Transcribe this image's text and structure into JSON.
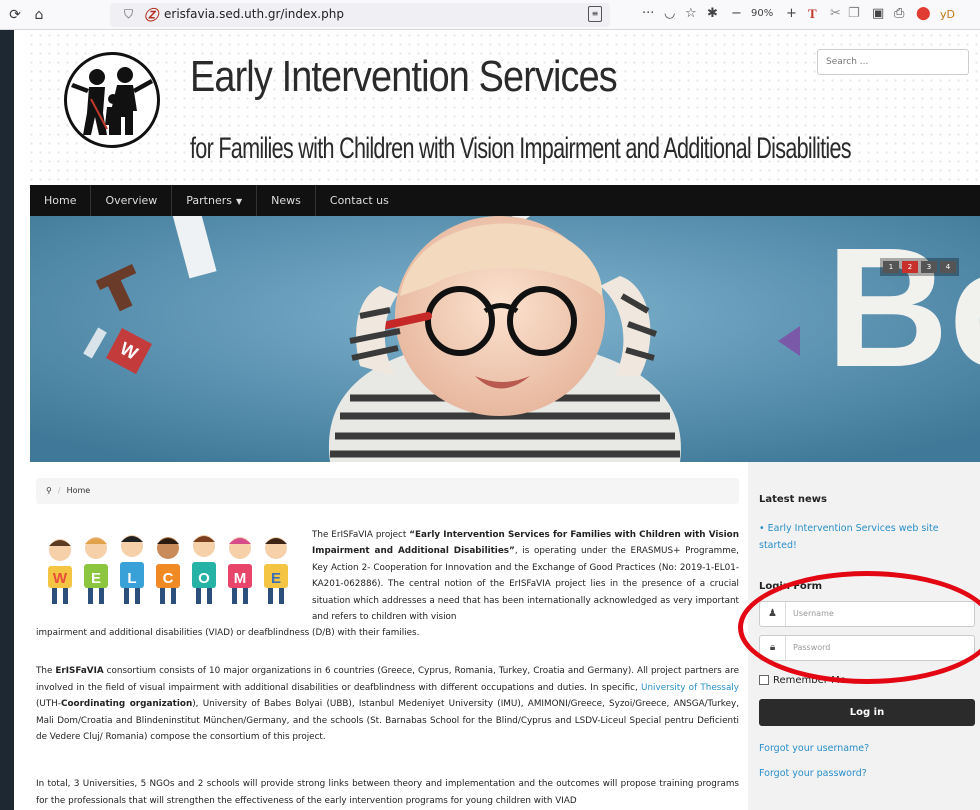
{
  "browser": {
    "url": "erisfavia.sed.uth.gr/index.php",
    "zoom": "90%",
    "icons": [
      "reload-icon",
      "home-icon",
      "shield-icon",
      "reader-icon",
      "more-icon",
      "pocket-icon",
      "bookmark-star-icon",
      "extension-icon",
      "zoom-out-icon",
      "zoom-in-icon"
    ]
  },
  "header": {
    "title": "Early Intervention Services",
    "subtitle": "for Families with Children with Vision Impairment and Additional Disabilities",
    "search_placeholder": "Search ..."
  },
  "nav": {
    "items": [
      {
        "label": "Home"
      },
      {
        "label": "Overview"
      },
      {
        "label": "Partners"
      },
      {
        "label": "News"
      },
      {
        "label": "Contact us"
      }
    ]
  },
  "slideshow": {
    "pages": [
      "1",
      "2",
      "3",
      "4"
    ],
    "active_page": "2"
  },
  "breadcrumb": {
    "current": "Home"
  },
  "article": {
    "welcome_letters": [
      "W",
      "E",
      "L",
      "C",
      "O",
      "M",
      "E"
    ],
    "p1_a": "The ErISFaVIA project ",
    "p1_b": "“Early Intervention Services for Families with Children with Vision Impairment and Additional Disabilities”",
    "p1_c": ", is operating under the ERASMUS+ Programme, Key Action 2- Cooperation for Innovation and the Exchange of Good Practices (No: 2019-1-EL01-KA201-062886). The central notion of the ErISFaVIA project lies in the presence of a crucial situation which addresses a need that has been internationally acknowledged as very important and refers to children with vision",
    "p1_d": "impairment and additional disabilities (VIAD) or deafblindness (D/B) with their families.",
    "p2_a": "The ",
    "p2_b": "ErISFaVIA",
    "p2_c": " consortium consists of 10 major organizations in 6 countries (Greece, Cyprus, Romania, Turkey, Croatia and Germany). All project partners are involved in the field of visual impairment with additional disabilities or deafblindness with different occupations and duties. In specific, ",
    "p2_link": "University of Thessaly",
    "p2_d": " (UTH-",
    "p2_e": "Coordinating organization",
    "p2_f": "), University of Babes Bolyai (UBB), Istanbul Medeniyet University (IMU), AMIMONI/Greece, Syzoi/Greece, ANSGA/Turkey, Mali Dom/Croatia and Blindeninstitut München/Germany, and the schools (St. Barnabas School for the Blind/Cyprus and LSDV-Liceul Special pentru Deficienti de Vedere Cluj/ Romania) compose the consortium of this project.",
    "p3": "In total, 3 Universities, 5 NGOs and 2 schools will provide strong links between theory and implementation and the outcomes will propose training programs for the professionals that will strengthen the effectiveness of the early intervention programs for young children with VIAD"
  },
  "sidebar": {
    "latest_news_title": "Latest news",
    "news_item": "Early Intervention Services web site started!",
    "login_title": "Login Form",
    "username_placeholder": "Username",
    "password_placeholder": "Password",
    "remember_label": "Remember Me",
    "login_button": "Log in",
    "forgot_username": "Forgot your username?",
    "forgot_password": "Forgot your password?"
  },
  "colors": {
    "nav_bg": "#111111",
    "link": "#2a8fc9",
    "annotation": "#e30613",
    "slide_active": "#c8302c"
  }
}
